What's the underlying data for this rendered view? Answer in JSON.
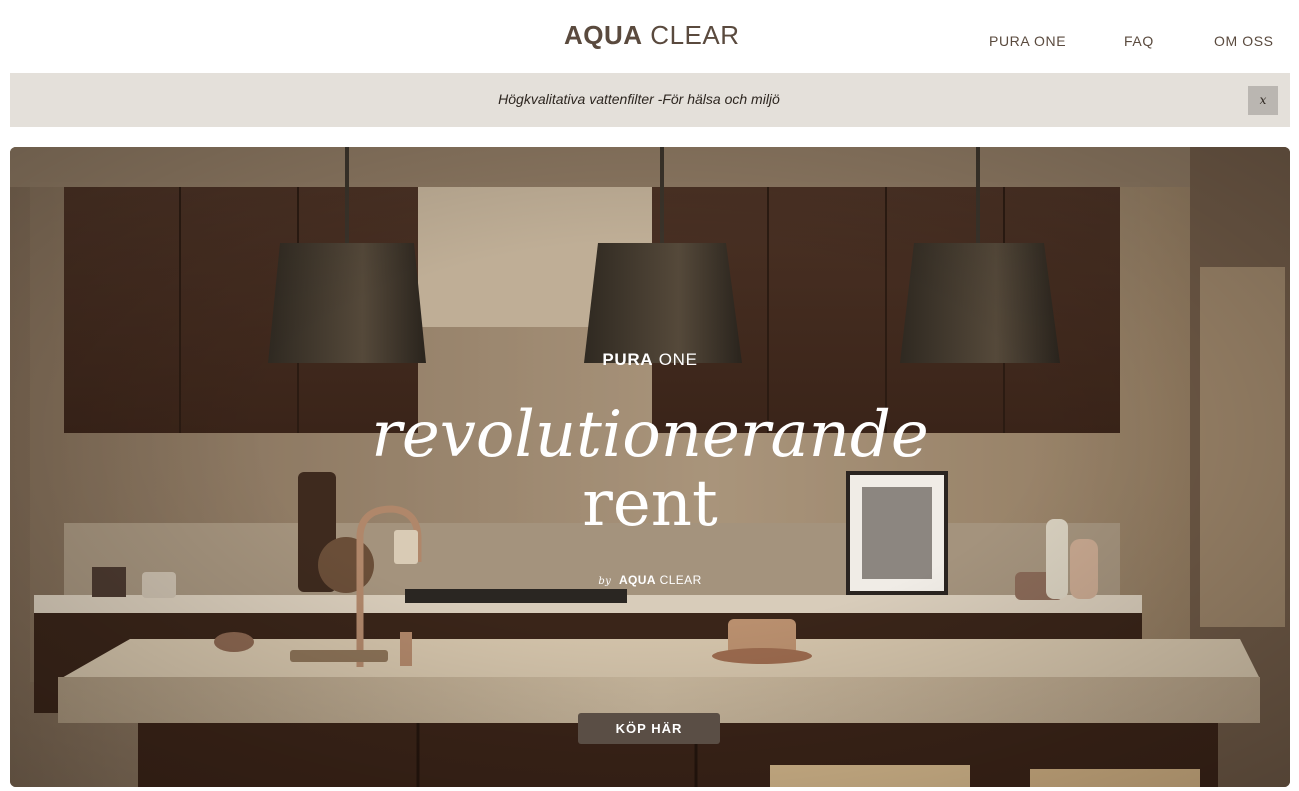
{
  "header": {
    "logo_bold": "AQUA",
    "logo_light": "CLEAR",
    "nav": [
      {
        "label": "PURA ONE"
      },
      {
        "label": "FAQ"
      },
      {
        "label": "OM OSS"
      }
    ]
  },
  "announcement": {
    "text": "Högkvalitativa vattenfilter -För hälsa och miljö",
    "close_label": "x"
  },
  "hero": {
    "product_bold": "PURA",
    "product_light": "ONE",
    "headline_italic": "revolutionerande",
    "headline_plain": "rent",
    "byline_by": "by",
    "byline_bold": "AQUA",
    "byline_light": "CLEAR",
    "cta_label": "KÖP HÄR",
    "image_icon": "kitchen-photo"
  },
  "colors": {
    "brand_text": "#5a4a3e",
    "banner_bg": "#e4e0da",
    "cta_bg": "#5a4e45",
    "hero_text": "#ffffff"
  }
}
